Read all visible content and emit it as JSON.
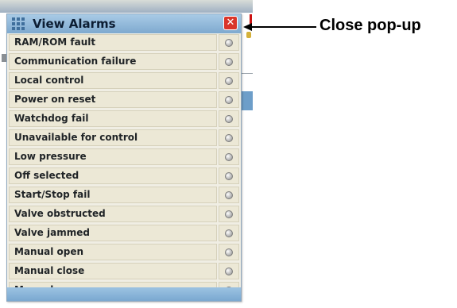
{
  "popup": {
    "title": "View Alarms",
    "close_symbol": "✕",
    "icons": {
      "app_icon": "grid-icon",
      "close_icon": "close-icon",
      "status_icon": "led-indicator-icon"
    },
    "colors": {
      "title_bar": "#8fb7db",
      "row_bg": "#ece8d6",
      "close_bg": "#d9352a",
      "led": "#bdbdbd"
    },
    "alarms": [
      {
        "label": "RAM/ROM fault",
        "state": "off"
      },
      {
        "label": "Communication failure",
        "state": "off"
      },
      {
        "label": "Local control",
        "state": "off"
      },
      {
        "label": "Power on reset",
        "state": "off"
      },
      {
        "label": "Watchdog fail",
        "state": "off"
      },
      {
        "label": "Unavailable for control",
        "state": "off"
      },
      {
        "label": "Low pressure",
        "state": "off"
      },
      {
        "label": "Off selected",
        "state": "off"
      },
      {
        "label": "Start/Stop fail",
        "state": "off"
      },
      {
        "label": "Valve obstructed",
        "state": "off"
      },
      {
        "label": "Valve jammed",
        "state": "off"
      },
      {
        "label": "Manual open",
        "state": "off"
      },
      {
        "label": "Manual close",
        "state": "off"
      },
      {
        "label": "Manual move",
        "state": "off"
      }
    ]
  },
  "annotation": {
    "callout_text": "Close pop-up"
  }
}
